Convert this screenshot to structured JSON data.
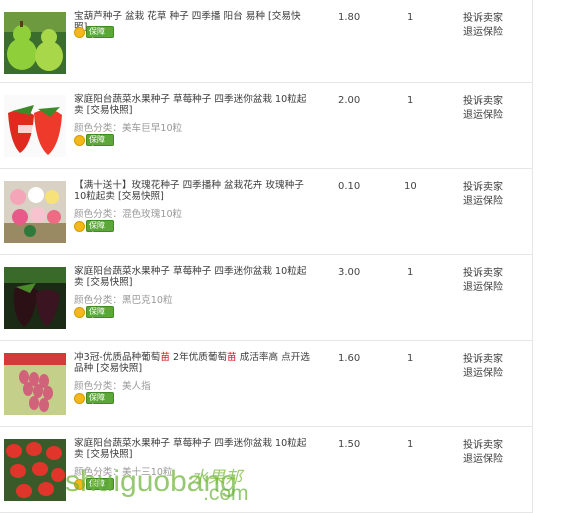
{
  "orders": [
    {
      "title_parts": [
        {
          "t": "宝葫芦种子 盆栽 花草 种子 四季播 阳台 易种 [交易快照]",
          "hl": false
        }
      ],
      "attr": "",
      "badge": "保障卡",
      "price": "1.80",
      "qty": "1",
      "actions": [
        "投诉卖家",
        "退运保险"
      ],
      "image_icon": "gourd-image"
    },
    {
      "title_parts": [
        {
          "t": "家庭阳台蔬菜水果种子 草莓种子 四季迷你盆栽 10粒起卖 [交易快照]",
          "hl": false
        }
      ],
      "attr": "颜色分类：美车巨早10粒",
      "badge": "保障卡",
      "price": "2.00",
      "qty": "1",
      "actions": [
        "投诉卖家",
        "退运保险"
      ],
      "image_icon": "strawberry-image"
    },
    {
      "title_parts": [
        {
          "t": "【满十送十】玫瑰花种子 四季播种 盆栽花卉 玫瑰种子 10粒起卖 [交易快照]",
          "hl": false
        }
      ],
      "attr": "颜色分类：混色玫瑰10粒",
      "badge": "保障卡",
      "price": "0.10",
      "qty": "10",
      "actions": [
        "投诉卖家",
        "退运保险"
      ],
      "image_icon": "rose-image"
    },
    {
      "title_parts": [
        {
          "t": "家庭阳台蔬菜水果种子 草莓种子 四季迷你盆栽 10粒起卖 [交易快照]",
          "hl": false
        }
      ],
      "attr": "颜色分类：黑巴克10粒",
      "badge": "保障卡",
      "price": "3.00",
      "qty": "1",
      "actions": [
        "投诉卖家",
        "退运保险"
      ],
      "image_icon": "black-strawberry-image"
    },
    {
      "title_parts": [
        {
          "t": "冲3冠-优质品种葡萄",
          "hl": false
        },
        {
          "t": "苗",
          "hl": true
        },
        {
          "t": " 2年优质葡萄",
          "hl": false
        },
        {
          "t": "苗",
          "hl": true
        },
        {
          "t": " 成活率高 点开选品种 [交易快照]",
          "hl": false
        }
      ],
      "attr": "颜色分类：美人指",
      "badge": "保障卡",
      "price": "1.60",
      "qty": "1",
      "actions": [
        "投诉卖家",
        "退运保险"
      ],
      "image_icon": "grape-image"
    },
    {
      "title_parts": [
        {
          "t": "家庭阳台蔬菜水果种子 草莓种子 四季迷你盆栽 10粒起卖 [交易快照]",
          "hl": false
        }
      ],
      "attr": "颜色分类：美十三10粒",
      "badge": "保障卡",
      "price": "1.50",
      "qty": "1",
      "actions": [
        "投诉卖家",
        "退运保险"
      ],
      "image_icon": "strawberry-bed-image"
    }
  ],
  "watermark": {
    "latin": "shuiguobang",
    "cn": "水果邦",
    "com": ".com"
  },
  "colors": {
    "highlight": "#dd0000",
    "badge_green": "#5da63a",
    "attr_grey": "#999999"
  }
}
